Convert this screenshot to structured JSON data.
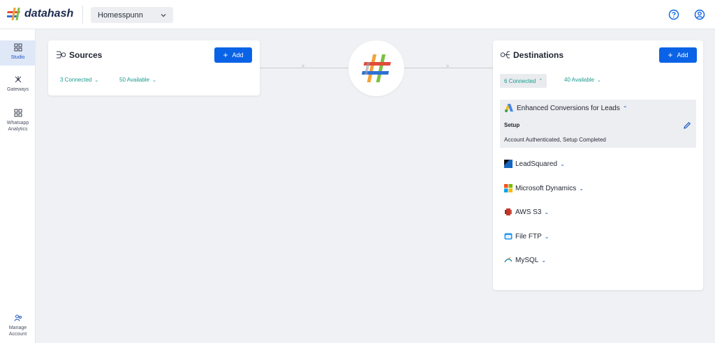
{
  "brand": {
    "name": "datahash"
  },
  "workspace": {
    "selected": "Homesspunn"
  },
  "sidenav": {
    "items": [
      {
        "label": "Studio",
        "icon": "grid-icon",
        "active": true
      },
      {
        "label": "Gateways",
        "icon": "network-icon",
        "active": false
      },
      {
        "label": "Whatsapp Analytics",
        "icon": "grid-icon",
        "active": false
      },
      {
        "label": "Manage Account",
        "icon": "users-icon",
        "active": false
      }
    ]
  },
  "sources": {
    "title": "Sources",
    "add_label": "Add",
    "connected": "3 Connected",
    "available": "50 Available"
  },
  "destinations": {
    "title": "Destinations",
    "add_label": "Add",
    "connected": "6 Connected",
    "available": "40 Available",
    "expanded": {
      "name": "Enhanced Conversions for Leads",
      "setup_label": "Setup",
      "setup_status": "Account Authenticated, Setup Completed"
    },
    "items": [
      {
        "name": "LeadSquared",
        "icon": "leadsquared-icon"
      },
      {
        "name": "Microsoft Dynamics",
        "icon": "microsoft-icon"
      },
      {
        "name": "AWS S3",
        "icon": "aws-s3-icon"
      },
      {
        "name": "File FTP",
        "icon": "file-ftp-icon"
      },
      {
        "name": "MySQL",
        "icon": "mysql-icon"
      }
    ]
  },
  "colors": {
    "accent": "#0a63e6",
    "teal": "#1a9a8e",
    "nav_active_bg": "#dfe8f7"
  }
}
